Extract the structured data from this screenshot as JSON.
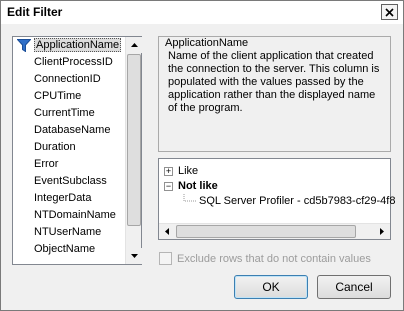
{
  "window": {
    "title": "Edit Filter"
  },
  "columns": {
    "items": [
      "ApplicationName",
      "ClientProcessID",
      "ConnectionID",
      "CPUTime",
      "CurrentTime",
      "DatabaseName",
      "Duration",
      "Error",
      "EventSubclass",
      "IntegerData",
      "NTDomainName",
      "NTUserName",
      "ObjectName"
    ],
    "selected_index": 0
  },
  "description": {
    "title": "ApplicationName",
    "text": "Name of the client application that created the connection to the server. This column is populated with the values passed by the application rather than the displayed name of the program."
  },
  "tree": {
    "like": {
      "expander": "+",
      "label": "Like"
    },
    "not_like": {
      "expander": "−",
      "label": "Not like"
    },
    "value": "SQL Server Profiler - cd5b7983-cf29-4f8"
  },
  "options": {
    "exclude_label": "Exclude rows that do not contain values",
    "exclude_checked": false,
    "exclude_enabled": false
  },
  "buttons": {
    "ok": "OK",
    "cancel": "Cancel"
  },
  "colors": {
    "accent": "#3c7fb1",
    "funnel": "#2f6fc8",
    "disabled_text": "#9c9c9c"
  }
}
